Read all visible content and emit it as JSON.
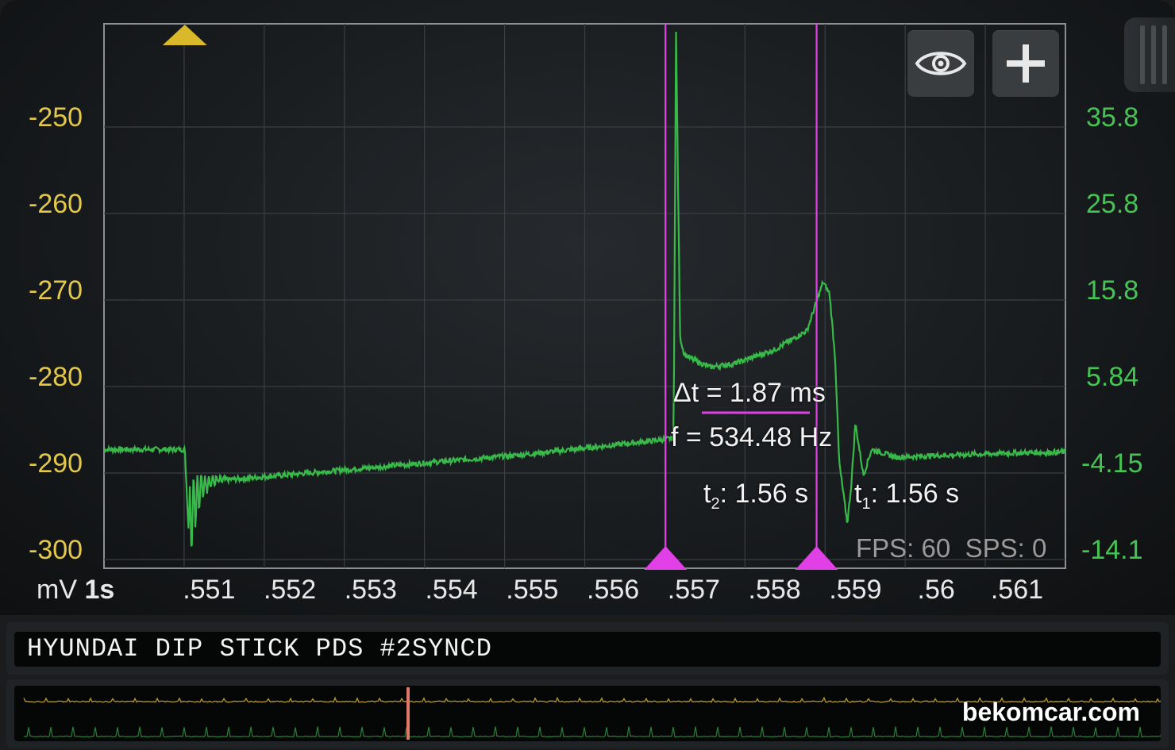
{
  "chart_data": {
    "type": "line",
    "xlabel": "",
    "x_ticks": [
      ".551",
      ".552",
      ".553",
      ".554",
      ".555",
      ".556",
      ".557",
      ".558",
      ".559",
      ".56",
      ".561"
    ],
    "xlim": [
      0.5497,
      0.5616
    ],
    "left_axis": {
      "unit": "mV",
      "ticks": [
        "-250",
        "-260",
        "-270",
        "-280",
        "-290",
        "-300"
      ],
      "color": "#e3c84a"
    },
    "right_axis": {
      "ticks": [
        "35.8",
        "25.8",
        "15.8",
        "5.84",
        "-4.15",
        "-14.1"
      ],
      "color": "#45c453"
    },
    "series": [
      {
        "color": "#38b94a",
        "axis": "right",
        "x": [
          0.5497,
          0.5507,
          0.55075,
          0.5508,
          0.5509,
          0.551,
          0.5512,
          0.5515,
          0.552,
          0.553,
          0.554,
          0.555,
          0.556,
          0.5565,
          0.55675,
          0.55678,
          0.55683,
          0.55688,
          0.557,
          0.5572,
          0.5575,
          0.558,
          0.5584,
          0.5586,
          0.55868,
          0.55875,
          0.5588,
          0.5589,
          0.55895,
          0.559,
          0.5591,
          0.5592,
          0.5595,
          0.56,
          0.561,
          0.5616
        ],
        "y": [
          -2.5,
          -2.5,
          -12.5,
          -9,
          -7,
          -6.2,
          -6.0,
          -5.8,
          -5.4,
          -4.6,
          -3.8,
          -3.0,
          -2.0,
          -1.5,
          -1.2,
          46,
          10.5,
          8.5,
          7.8,
          7.0,
          7.4,
          9.0,
          11.2,
          16.8,
          15.5,
          8.0,
          -4.0,
          -11.0,
          -6.5,
          0.5,
          -5.5,
          -2.5,
          -3.4,
          -3.2,
          -2.9,
          -2.8
        ]
      }
    ],
    "cursors": [
      {
        "name": "t2",
        "x": 0.55665,
        "color": "#e040e6"
      },
      {
        "name": "t1",
        "x": 0.55852,
        "color": "#e040e6"
      }
    ],
    "trigger_marker": {
      "x": 0.5507,
      "color": "#d9b82a"
    }
  },
  "measurements": {
    "delta_t": "Δt = 1.87 ms",
    "freq": "f = 534.48 Hz",
    "t2": "1.56 s",
    "t1": "1.56 s",
    "t2_sym": "t",
    "t2_sub": "2",
    "t1_sym": "t",
    "t1_sub": "1"
  },
  "stats": {
    "fps": "FPS: 60",
    "sps": "SPS: 0"
  },
  "unit": {
    "mv": "mV",
    "timebase": "1s"
  },
  "toolbar": {
    "eye_icon": "eye-icon",
    "add_icon": "plus-icon"
  },
  "title": "HYUNDAI DIP STICK PDS #2SYNCD",
  "watermark": "bekomcar.com"
}
